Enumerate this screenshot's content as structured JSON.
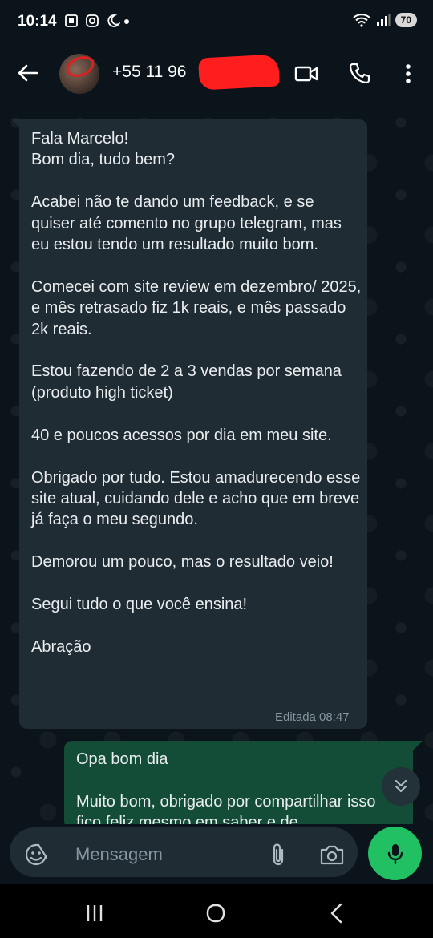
{
  "status_bar": {
    "time": "10:14",
    "battery": "70"
  },
  "header": {
    "contact_name": "+55 11 96"
  },
  "messages": {
    "incoming": {
      "text": "Fala Marcelo!\nBom dia, tudo bem?\n\nAcabei não te dando um feedback, e se quiser até comento no grupo telegram, mas eu estou tendo um resultado muito bom.\n\nComecei com site review em dezembro/ 2025, e mês retrasado fiz 1k reais, e mês passado 2k reais.\n\nEstou fazendo de 2 a 3 vendas por semana (produto high ticket)\n\n40 e poucos acessos por dia em meu site.\n\nObrigado por tudo. Estou amadurecendo esse site atual, cuidando dele e acho que em breve já faça o meu segundo.\n\nDemorou um pouco, mas o resultado veio!\n\nSegui tudo o que você ensina!\n\nAbração",
      "meta": "Editada 08:47"
    },
    "outgoing": {
      "text": "Opa bom dia\n\nMuito bom, obrigado por compartilhar isso fico feliz mesmo em saber e de"
    }
  },
  "input_bar": {
    "placeholder": "Mensagem"
  },
  "icons": {
    "back": "arrow-back-icon",
    "video": "video-call-icon",
    "call": "phone-icon",
    "menu": "more-vert-icon",
    "emoji": "sticker-icon",
    "attach": "paperclip-icon",
    "camera": "camera-icon",
    "mic": "mic-icon",
    "scroll": "double-chevron-down-icon"
  },
  "colors": {
    "background": "#0b141a",
    "incoming_bubble": "#202c33",
    "outgoing_bubble": "#144d37",
    "accent": "#21c063"
  }
}
